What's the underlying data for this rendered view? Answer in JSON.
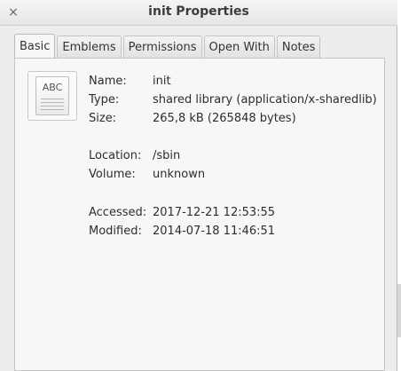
{
  "window": {
    "title": "init Properties",
    "close_glyph": "×"
  },
  "tabs": [
    {
      "label": "Basic",
      "active": true
    },
    {
      "label": "Emblems",
      "active": false
    },
    {
      "label": "Permissions",
      "active": false
    },
    {
      "label": "Open With",
      "active": false
    },
    {
      "label": "Notes",
      "active": false
    }
  ],
  "icon": {
    "name": "text-document-icon",
    "text": "ABC"
  },
  "fields": {
    "name": {
      "label": "Name:",
      "value": "init"
    },
    "type": {
      "label": "Type:",
      "value": "shared library (application/x-sharedlib)"
    },
    "size": {
      "label": "Size:",
      "value": "265,8 kB (265848 bytes)"
    },
    "location": {
      "label": "Location:",
      "value": "/sbin"
    },
    "volume": {
      "label": "Volume:",
      "value": "unknown"
    },
    "accessed": {
      "label": "Accessed:",
      "value": "2017-12-21 12:53:55"
    },
    "modified": {
      "label": "Modified:",
      "value": "2014-07-18 11:46:51"
    }
  }
}
